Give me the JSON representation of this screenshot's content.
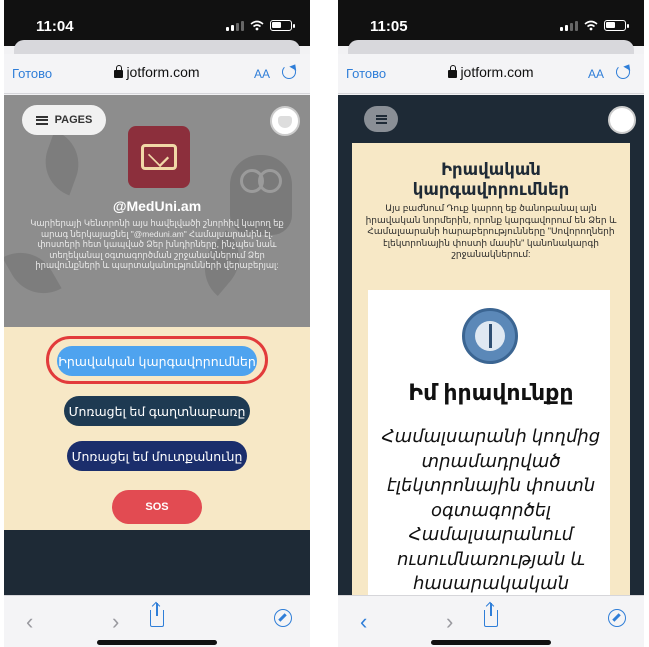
{
  "left": {
    "status": {
      "time": "11:04"
    },
    "browser": {
      "done": "Готово",
      "url": "jotform.com",
      "text_size": "AA"
    },
    "header": {
      "pages_label": "PAGES"
    },
    "profile": {
      "handle": "@MedUni.am",
      "description": "Կարիերայի Կենտրոնի այս հավելվածի շնորհիվ կարող եք արագ ներկայացնել \"@meduni.am\" Համալսարանին էլ. փոստերի հետ կապված Ձեր խնդիրները, ինչպես նաև տեղեկանալ օգտագործման շրջանակներում Ձեր իրավունքների և պարտականությունների վերաբերյալ:"
    },
    "buttons": {
      "rights": "Իրավական կարգավորումներ",
      "forgot_password": "Մոռացել եմ գաղտնաբառը",
      "forgot_login": "Մոռացել եմ մուտքանունը",
      "sos": "SOS"
    }
  },
  "right": {
    "status": {
      "time": "11:05"
    },
    "browser": {
      "done": "Готово",
      "url": "jotform.com",
      "text_size": "AA"
    },
    "title": "Իրավական կարգավորումներ",
    "description": "Այս բաժնում Դուք կարող եք ծանոթանալ այն իրավական նորմերին, որոնք կարգավորում են Ձեր և Համալսարանի հարաբերությունները \"Սովորողների էլեկտրոնային փոստի մասին\" կանոնակարգի շրջանակներում:",
    "card": {
      "heading": "Իմ իրավունքը",
      "body": "Համալսարանի կողմից տրամադրված էլեկտրոնային փոստն օգտագործել Համալսարանում ուսումնառության և հասարակական"
    }
  },
  "colors": {
    "accent_blue": "#2f7ed8",
    "rights_button": "#4ea3ef",
    "dark_navy": "#1e2a36",
    "panel_cream": "#f7e8c6",
    "sos_red": "#e24b52",
    "highlight_ring": "#e23b3b",
    "logo_maroon": "#8c2f3c"
  },
  "icons": [
    "lock-icon",
    "reload-icon",
    "menu-icon",
    "share-icon",
    "compass-icon",
    "back-icon",
    "forward-icon",
    "envelope-icon",
    "seal-icon",
    "avatar-icon"
  ]
}
